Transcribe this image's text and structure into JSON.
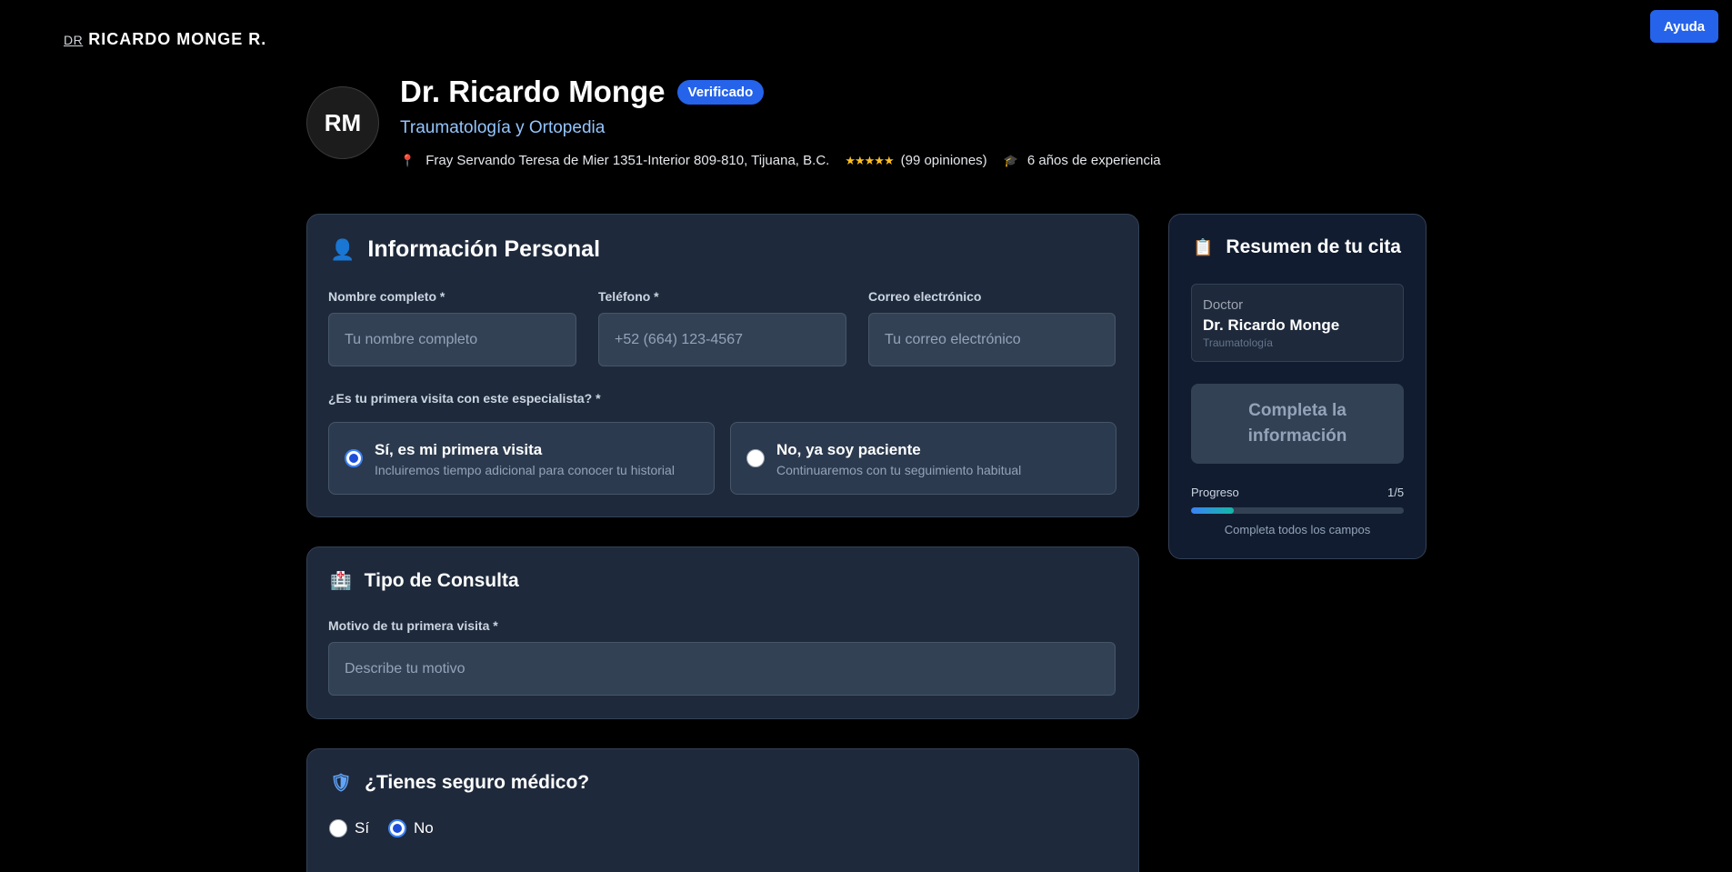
{
  "header": {
    "logo_prefix": "DR",
    "logo_name": "RICARDO MONGE R.",
    "help_label": "Ayuda"
  },
  "profile": {
    "initials": "RM",
    "name": "Dr. Ricardo Monge",
    "badge": "Verificado",
    "specialty": "Traumatología y Ortopedia",
    "address": "Fray Servando Teresa de Mier 1351-Interior 809-810, Tijuana, B.C.",
    "stars": "★★★★★",
    "reviews": "(99 opiniones)",
    "experience": "6 años de experiencia",
    "icons": {
      "location": "map-pin-icon",
      "experience": "graduation-cap-icon"
    }
  },
  "personal": {
    "title": "Información Personal",
    "icon": "user-icon",
    "name_label": "Nombre completo *",
    "name_placeholder": "Tu nombre completo",
    "name_value": "",
    "phone_label": "Teléfono *",
    "phone_placeholder": "+52 (664) 123-4567",
    "phone_value": "",
    "email_label": "Correo electrónico",
    "email_placeholder": "Tu correo electrónico",
    "email_value": "",
    "first_visit_question": "¿Es tu primera visita con este especialista? *",
    "options": [
      {
        "title": "Sí, es mi primera visita",
        "subtitle": "Incluiremos tiempo adicional para conocer tu historial",
        "checked": true
      },
      {
        "title": "No, ya soy paciente",
        "subtitle": "Continuaremos con tu seguimiento habitual",
        "checked": false
      }
    ]
  },
  "consulta": {
    "title": "Tipo de Consulta",
    "icon": "hospital-icon",
    "reason_label": "Motivo de tu primera visita *",
    "reason_placeholder": "Describe tu motivo",
    "reason_value": ""
  },
  "seguro": {
    "title": "¿Tienes seguro médico?",
    "icon": "shield-icon",
    "options": [
      {
        "label": "Sí",
        "checked": false
      },
      {
        "label": "No",
        "checked": true
      }
    ]
  },
  "summary": {
    "title": "Resumen de tu cita",
    "icon": "clipboard-icon",
    "doctor_label": "Doctor",
    "doctor_name": "Dr. Ricardo Monge",
    "doctor_specialty": "Traumatología",
    "button_label": "Completa la información",
    "progress_label": "Progreso",
    "progress_count": "1/5",
    "progress_fraction": 0.2,
    "progress_hint": "Completa todos los campos"
  },
  "colors": {
    "accent": "#2563eb",
    "card_bg": "#1e293b",
    "page_bg": "#000000"
  }
}
